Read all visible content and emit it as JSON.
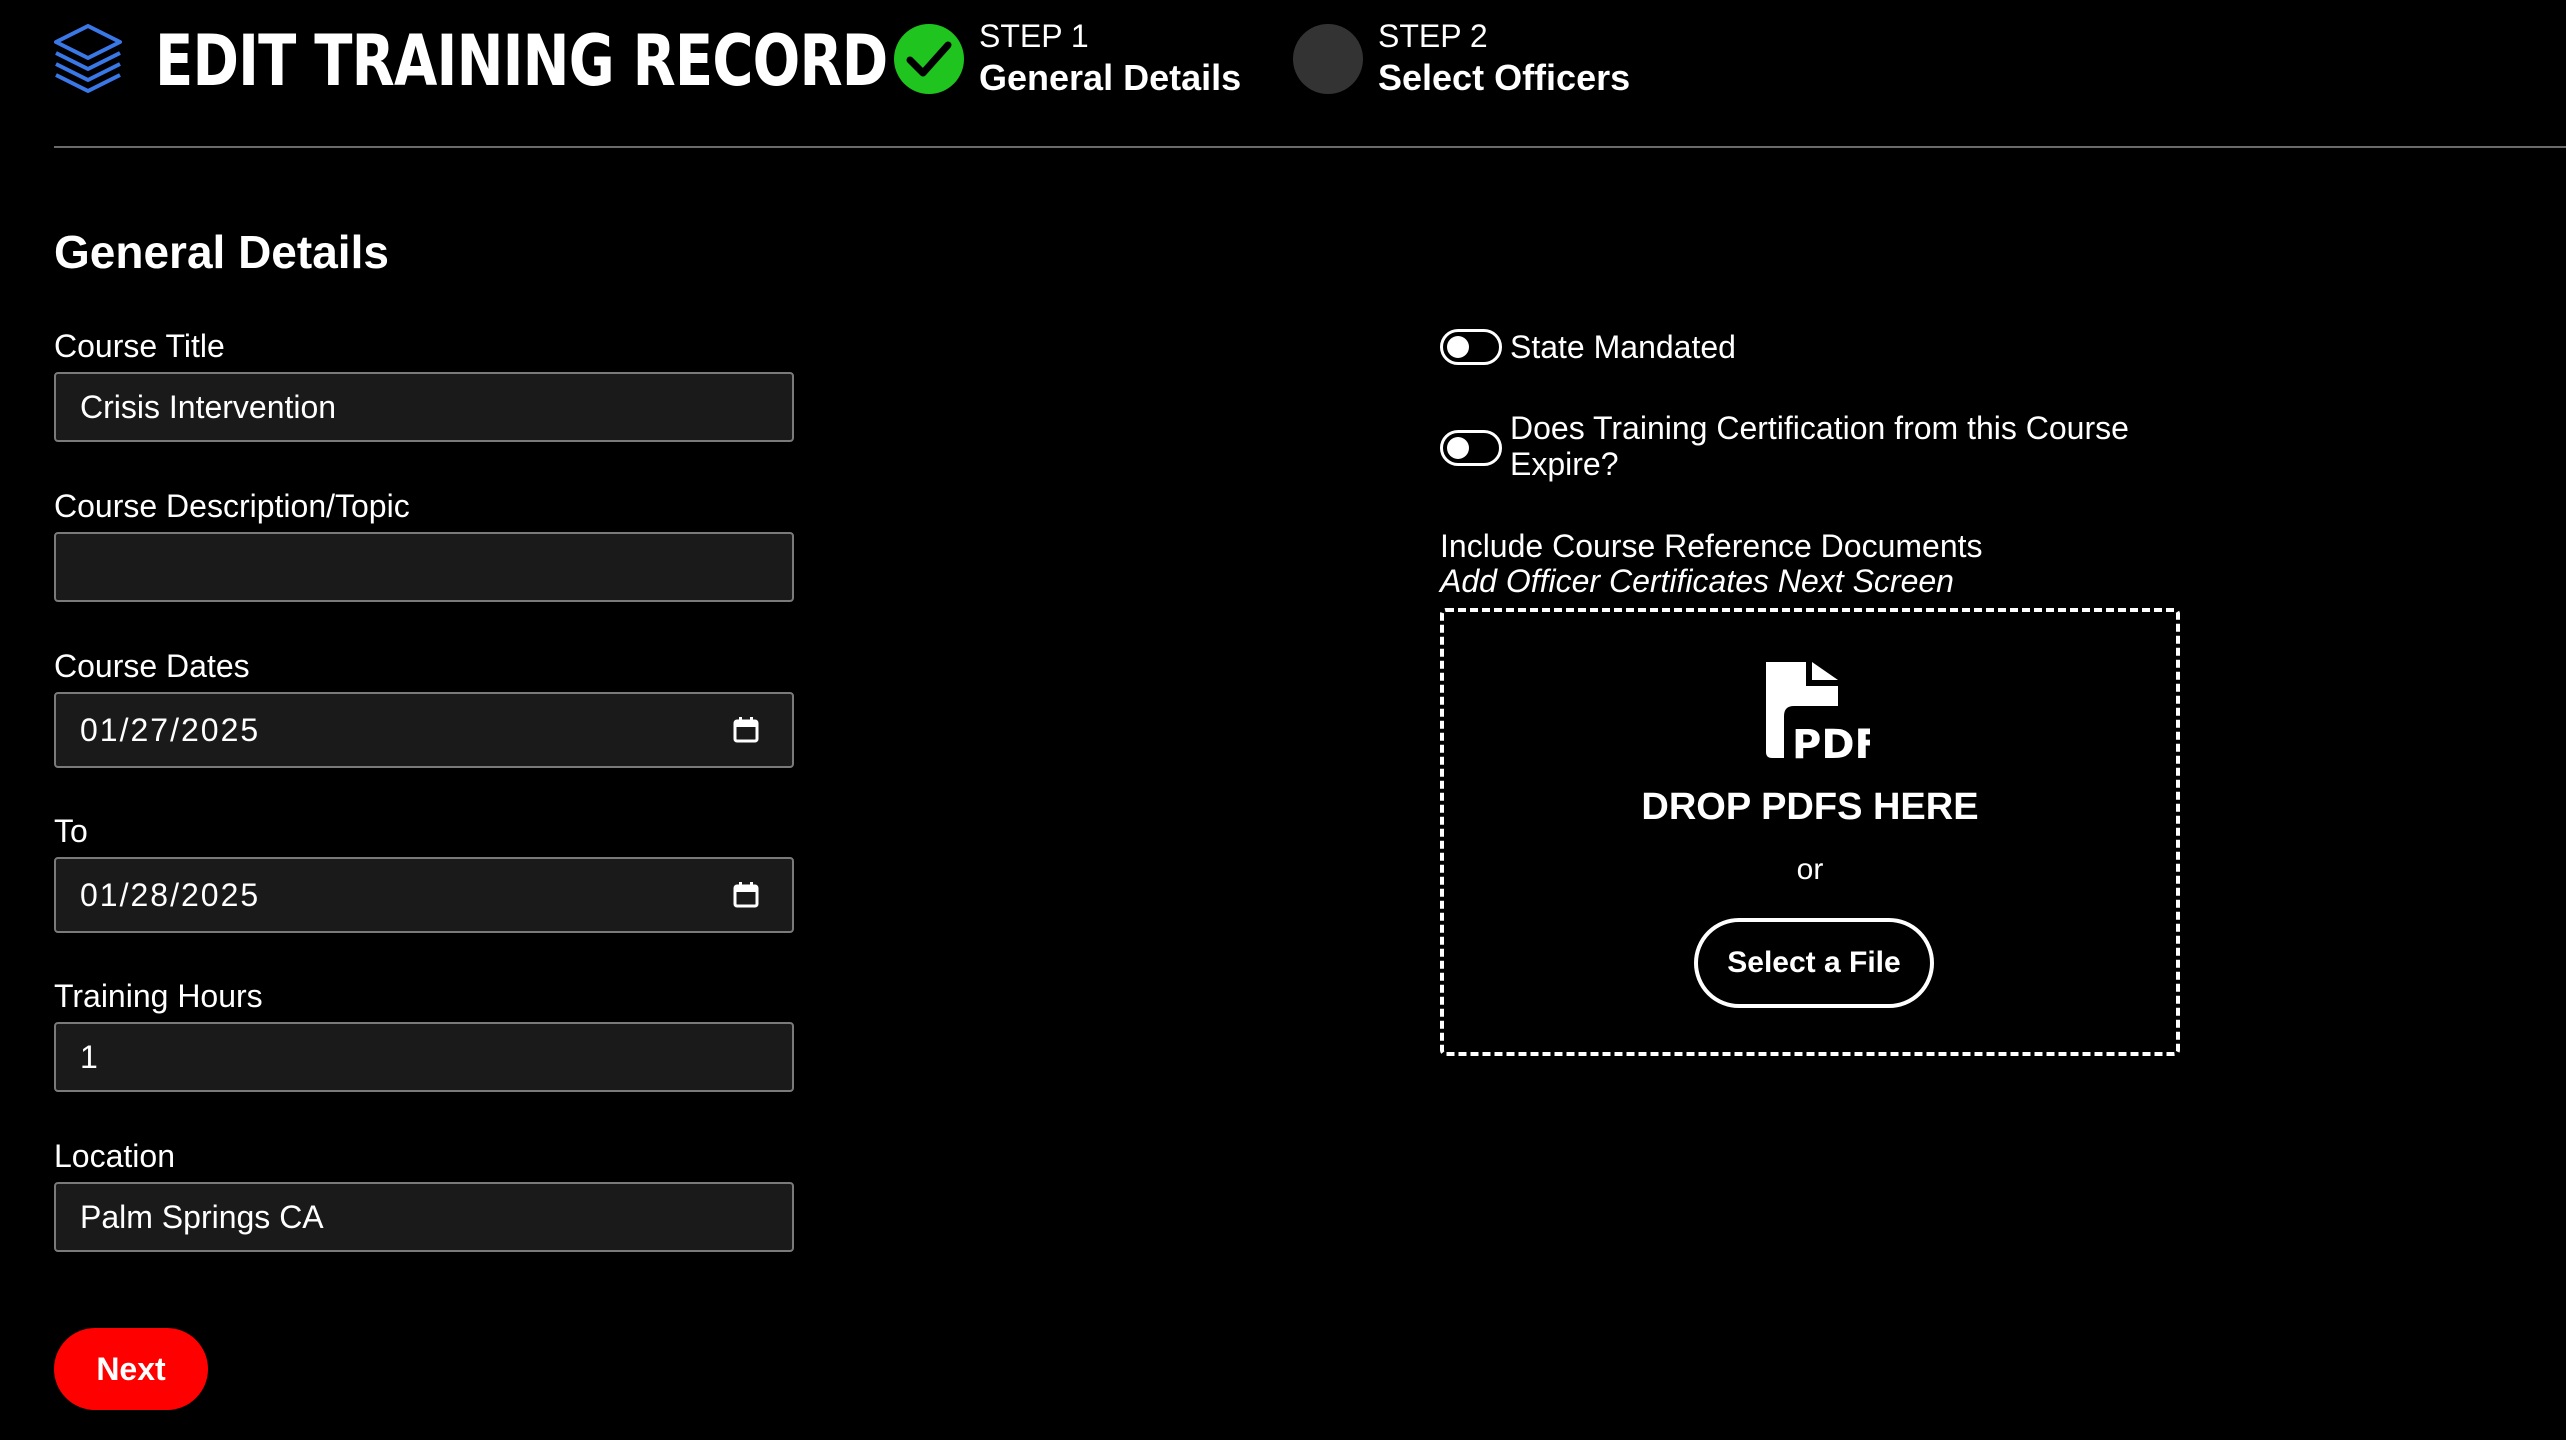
{
  "header": {
    "title": "EDIT TRAINING RECORD",
    "logo_icon": "stacked-layers-icon"
  },
  "steps": [
    {
      "number": "STEP 1",
      "name": "General Details",
      "status": "complete",
      "color": "#1fc41f"
    },
    {
      "number": "STEP 2",
      "name": "Select Officers",
      "status": "pending",
      "color": "#333333"
    }
  ],
  "form": {
    "section_title": "General Details",
    "course_title": {
      "label": "Course Title",
      "value": "Crisis Intervention"
    },
    "course_description": {
      "label": "Course Description/Topic",
      "value": ""
    },
    "course_dates": {
      "label": "Course Dates",
      "value": "01/27/2025",
      "icon": "calendar-icon"
    },
    "course_dates_to": {
      "label": "To",
      "value": "01/28/2025",
      "icon": "calendar-icon"
    },
    "training_hours": {
      "label": "Training Hours",
      "value": "1"
    },
    "location": {
      "label": "Location",
      "value": "Palm Springs CA"
    },
    "next_label": "Next",
    "next_color": "#ff0000"
  },
  "options": {
    "state_mandated": {
      "label": "State Mandated",
      "checked": false
    },
    "certification_expires": {
      "label": "Does Training Certification from this Course Expire?",
      "checked": false
    }
  },
  "documents": {
    "label": "Include Course Reference Documents",
    "note": "Add Officer Certificates Next Screen",
    "drop_text": "DROP PDFS HERE",
    "or_text": "or",
    "select_label": "Select a File",
    "icon": "pdf-file-icon",
    "icon_text": "PDF"
  }
}
